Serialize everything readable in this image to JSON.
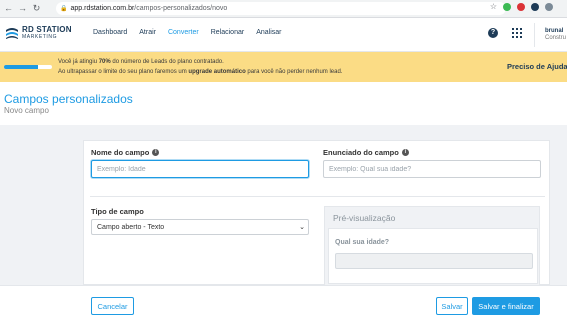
{
  "browser": {
    "url_domain": "app.rdstation.com.br",
    "url_path": "/campos-personalizados/novo"
  },
  "header": {
    "logo_main": "RD STATION",
    "logo_sub": "MARKETING",
    "nav": [
      {
        "label": "Dashboard"
      },
      {
        "label": "Atrair"
      },
      {
        "label": "Converter",
        "active": true
      },
      {
        "label": "Relacionar"
      },
      {
        "label": "Analisar"
      }
    ],
    "user_name": "brunal",
    "user_company": "Constru"
  },
  "banner": {
    "progress_percent": 70,
    "line1_prefix": "Você já atingiu ",
    "line1_bold": "70%",
    "line1_suffix": " do número de Leads do plano contratado.",
    "line2_prefix": "Ao ultrapassar o limite do seu plano faremos um ",
    "line2_bold": "upgrade automático",
    "line2_suffix": " para você não perder nenhum lead.",
    "cta": "Preciso de Ajuda"
  },
  "page": {
    "title": "Campos personalizados",
    "subtitle": "Novo campo"
  },
  "form": {
    "field_name_label": "Nome do campo",
    "field_name_placeholder": "Exemplo: Idade",
    "question_label": "Enunciado do campo",
    "question_placeholder": "Exemplo: Qual sua idade?",
    "field_type_label": "Tipo de campo",
    "field_type_value": "Campo aberto - Texto",
    "preview_title": "Pré-visualização",
    "preview_question": "Qual sua idade?"
  },
  "footer": {
    "cancel": "Cancelar",
    "save": "Salvar",
    "save_finish": "Salvar e finalizar"
  },
  "colors": {
    "accent": "#1e9be3",
    "navy": "#1d3b57",
    "banner": "#fbdc85"
  }
}
